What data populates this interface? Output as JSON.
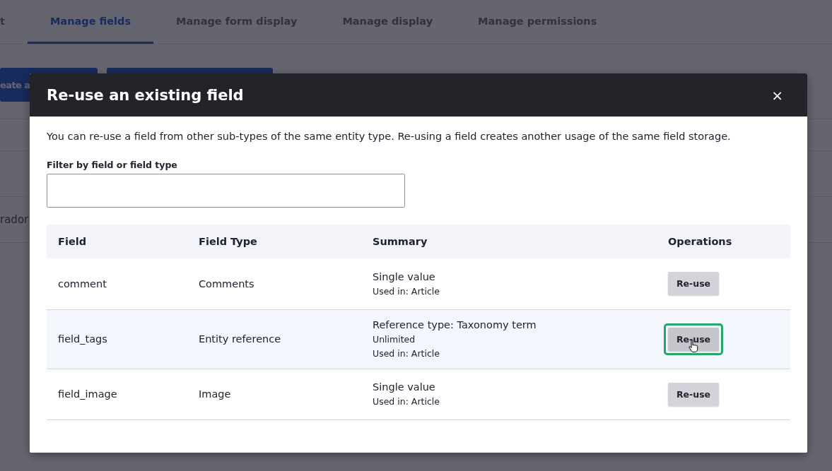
{
  "page": {
    "tabs": [
      {
        "label": "t",
        "selected": false
      },
      {
        "label": "Manage fields",
        "selected": true
      },
      {
        "label": "Manage form display",
        "selected": false
      },
      {
        "label": "Manage display",
        "selected": false
      },
      {
        "label": "Manage permissions",
        "selected": false
      }
    ],
    "action_button": "eate a",
    "row_text": "rador"
  },
  "dialog": {
    "title": "Re-use an existing field",
    "close": "×",
    "description": "You can re-use a field from other sub-types of the same entity type. Re-using a field creates another usage of the same field storage.",
    "filter": {
      "label": "Filter by field or field type"
    },
    "table": {
      "columns": [
        "Field",
        "Field Type",
        "Summary",
        "Operations"
      ],
      "rows": [
        {
          "field": "comment",
          "type": "Comments",
          "summary": [
            "Single value",
            "Used in: Article"
          ],
          "button": "Re-use",
          "highlighted": false,
          "focused": false
        },
        {
          "field": "field_tags",
          "type": "Entity reference",
          "summary": [
            "Reference type: Taxonomy term",
            "Unlimited",
            "Used in: Article"
          ],
          "button": "Re-use",
          "highlighted": true,
          "focused": true
        },
        {
          "field": "field_image",
          "type": "Image",
          "summary": [
            "Single value",
            "Used in: Article"
          ],
          "button": "Re-use",
          "highlighted": false,
          "focused": false
        }
      ]
    }
  }
}
